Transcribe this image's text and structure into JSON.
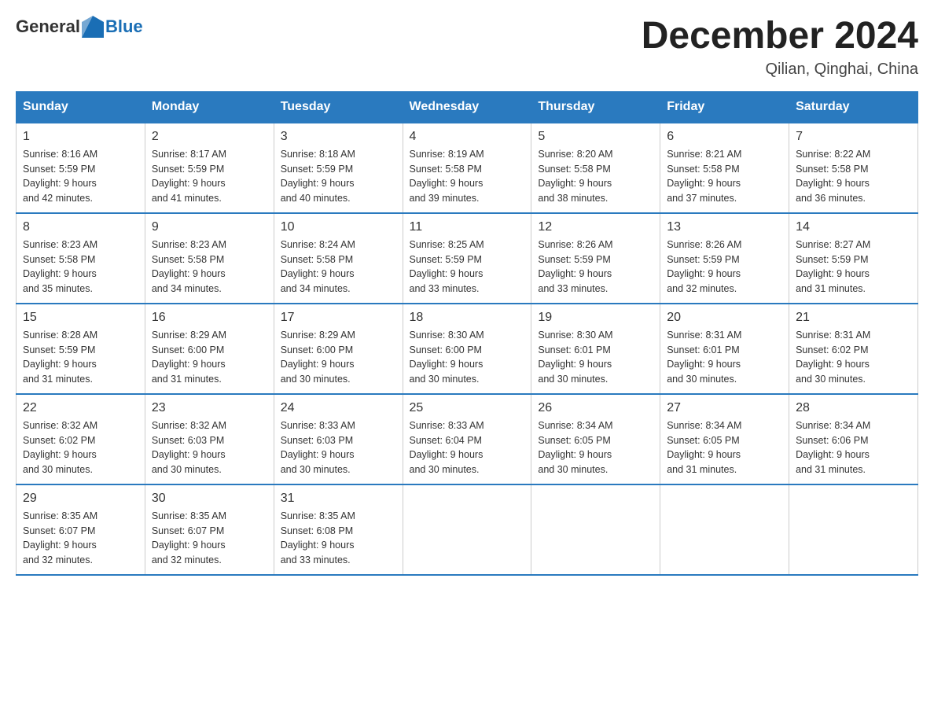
{
  "header": {
    "logo_general": "General",
    "logo_blue": "Blue",
    "month_title": "December 2024",
    "location": "Qilian, Qinghai, China"
  },
  "days_of_week": [
    "Sunday",
    "Monday",
    "Tuesday",
    "Wednesday",
    "Thursday",
    "Friday",
    "Saturday"
  ],
  "weeks": [
    [
      {
        "day": "1",
        "sunrise": "8:16 AM",
        "sunset": "5:59 PM",
        "daylight": "9 hours and 42 minutes."
      },
      {
        "day": "2",
        "sunrise": "8:17 AM",
        "sunset": "5:59 PM",
        "daylight": "9 hours and 41 minutes."
      },
      {
        "day": "3",
        "sunrise": "8:18 AM",
        "sunset": "5:59 PM",
        "daylight": "9 hours and 40 minutes."
      },
      {
        "day": "4",
        "sunrise": "8:19 AM",
        "sunset": "5:58 PM",
        "daylight": "9 hours and 39 minutes."
      },
      {
        "day": "5",
        "sunrise": "8:20 AM",
        "sunset": "5:58 PM",
        "daylight": "9 hours and 38 minutes."
      },
      {
        "day": "6",
        "sunrise": "8:21 AM",
        "sunset": "5:58 PM",
        "daylight": "9 hours and 37 minutes."
      },
      {
        "day": "7",
        "sunrise": "8:22 AM",
        "sunset": "5:58 PM",
        "daylight": "9 hours and 36 minutes."
      }
    ],
    [
      {
        "day": "8",
        "sunrise": "8:23 AM",
        "sunset": "5:58 PM",
        "daylight": "9 hours and 35 minutes."
      },
      {
        "day": "9",
        "sunrise": "8:23 AM",
        "sunset": "5:58 PM",
        "daylight": "9 hours and 34 minutes."
      },
      {
        "day": "10",
        "sunrise": "8:24 AM",
        "sunset": "5:58 PM",
        "daylight": "9 hours and 34 minutes."
      },
      {
        "day": "11",
        "sunrise": "8:25 AM",
        "sunset": "5:59 PM",
        "daylight": "9 hours and 33 minutes."
      },
      {
        "day": "12",
        "sunrise": "8:26 AM",
        "sunset": "5:59 PM",
        "daylight": "9 hours and 33 minutes."
      },
      {
        "day": "13",
        "sunrise": "8:26 AM",
        "sunset": "5:59 PM",
        "daylight": "9 hours and 32 minutes."
      },
      {
        "day": "14",
        "sunrise": "8:27 AM",
        "sunset": "5:59 PM",
        "daylight": "9 hours and 31 minutes."
      }
    ],
    [
      {
        "day": "15",
        "sunrise": "8:28 AM",
        "sunset": "5:59 PM",
        "daylight": "9 hours and 31 minutes."
      },
      {
        "day": "16",
        "sunrise": "8:29 AM",
        "sunset": "6:00 PM",
        "daylight": "9 hours and 31 minutes."
      },
      {
        "day": "17",
        "sunrise": "8:29 AM",
        "sunset": "6:00 PM",
        "daylight": "9 hours and 30 minutes."
      },
      {
        "day": "18",
        "sunrise": "8:30 AM",
        "sunset": "6:00 PM",
        "daylight": "9 hours and 30 minutes."
      },
      {
        "day": "19",
        "sunrise": "8:30 AM",
        "sunset": "6:01 PM",
        "daylight": "9 hours and 30 minutes."
      },
      {
        "day": "20",
        "sunrise": "8:31 AM",
        "sunset": "6:01 PM",
        "daylight": "9 hours and 30 minutes."
      },
      {
        "day": "21",
        "sunrise": "8:31 AM",
        "sunset": "6:02 PM",
        "daylight": "9 hours and 30 minutes."
      }
    ],
    [
      {
        "day": "22",
        "sunrise": "8:32 AM",
        "sunset": "6:02 PM",
        "daylight": "9 hours and 30 minutes."
      },
      {
        "day": "23",
        "sunrise": "8:32 AM",
        "sunset": "6:03 PM",
        "daylight": "9 hours and 30 minutes."
      },
      {
        "day": "24",
        "sunrise": "8:33 AM",
        "sunset": "6:03 PM",
        "daylight": "9 hours and 30 minutes."
      },
      {
        "day": "25",
        "sunrise": "8:33 AM",
        "sunset": "6:04 PM",
        "daylight": "9 hours and 30 minutes."
      },
      {
        "day": "26",
        "sunrise": "8:34 AM",
        "sunset": "6:05 PM",
        "daylight": "9 hours and 30 minutes."
      },
      {
        "day": "27",
        "sunrise": "8:34 AM",
        "sunset": "6:05 PM",
        "daylight": "9 hours and 31 minutes."
      },
      {
        "day": "28",
        "sunrise": "8:34 AM",
        "sunset": "6:06 PM",
        "daylight": "9 hours and 31 minutes."
      }
    ],
    [
      {
        "day": "29",
        "sunrise": "8:35 AM",
        "sunset": "6:07 PM",
        "daylight": "9 hours and 32 minutes."
      },
      {
        "day": "30",
        "sunrise": "8:35 AM",
        "sunset": "6:07 PM",
        "daylight": "9 hours and 32 minutes."
      },
      {
        "day": "31",
        "sunrise": "8:35 AM",
        "sunset": "6:08 PM",
        "daylight": "9 hours and 33 minutes."
      },
      null,
      null,
      null,
      null
    ]
  ],
  "labels": {
    "sunrise": "Sunrise:",
    "sunset": "Sunset:",
    "daylight": "Daylight:"
  }
}
